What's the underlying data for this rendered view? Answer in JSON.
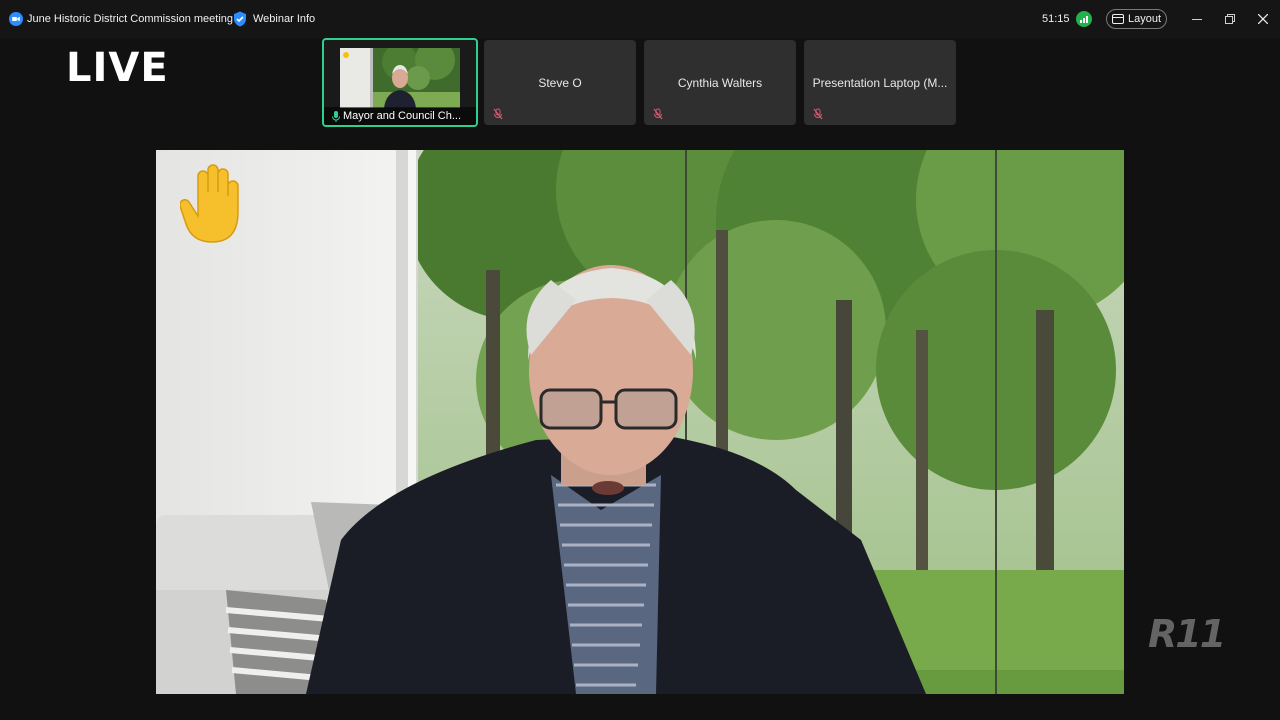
{
  "titlebar": {
    "meeting_title": "June Historic District Commission meeting",
    "webinar_info_label": "Webinar Info",
    "timer": "51:15",
    "layout_label": "Layout"
  },
  "live_label": "LIVE",
  "participants": [
    {
      "name": "Mayor and Council Ch...",
      "active": true,
      "video": true,
      "muted": false
    },
    {
      "name": "Steve O",
      "active": false,
      "video": false,
      "muted": true
    },
    {
      "name": "Cynthia Walters",
      "active": false,
      "video": false,
      "muted": true
    },
    {
      "name": "Presentation Laptop (M...",
      "active": false,
      "video": false,
      "muted": true
    }
  ],
  "main_video": {
    "reaction": "raised-hand",
    "background": "forest-virtual-background"
  },
  "watermark": "R11",
  "colors": {
    "active_border": "#2ecf8f",
    "network_good": "#22b24c",
    "muted_red": "#e0566b",
    "background": "#111111"
  },
  "icons": {
    "app": "zoom-logo-icon",
    "webinar": "shield-icon",
    "network": "network-signal-icon",
    "layout": "layout-grid-icon",
    "mic_muted": "mic-muted-icon",
    "mic_on": "mic-icon",
    "reaction": "raised-hand-icon"
  }
}
